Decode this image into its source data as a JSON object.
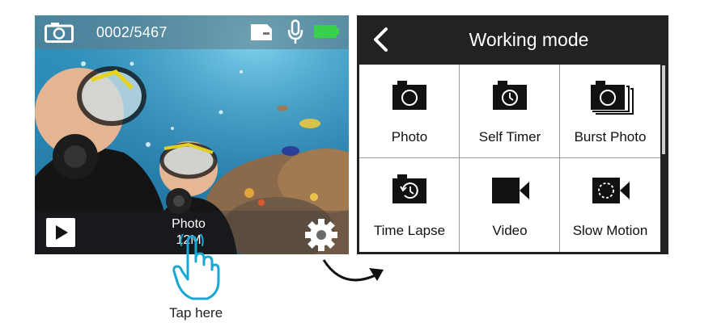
{
  "camera": {
    "counter": "0002/5467",
    "mode_name": "Photo",
    "mode_resolution": "12M",
    "icons": [
      "camera-icon",
      "sd-card-icon",
      "microphone-icon",
      "battery-icon",
      "play-icon",
      "gear-icon"
    ]
  },
  "instruction": {
    "tap_label": "Tap here"
  },
  "menu": {
    "title": "Working mode",
    "items": [
      {
        "label": "Photo",
        "icon": "camera-icon"
      },
      {
        "label": "Self Timer",
        "icon": "self-timer-icon"
      },
      {
        "label": "Burst Photo",
        "icon": "burst-photo-icon"
      },
      {
        "label": "Time Lapse",
        "icon": "time-lapse-icon"
      },
      {
        "label": "Video",
        "icon": "video-icon"
      },
      {
        "label": "Slow Motion",
        "icon": "slow-motion-icon"
      }
    ]
  },
  "colors": {
    "battery": "#39d04a",
    "menu_bg": "#222222",
    "grid_bg": "#ffffff"
  }
}
